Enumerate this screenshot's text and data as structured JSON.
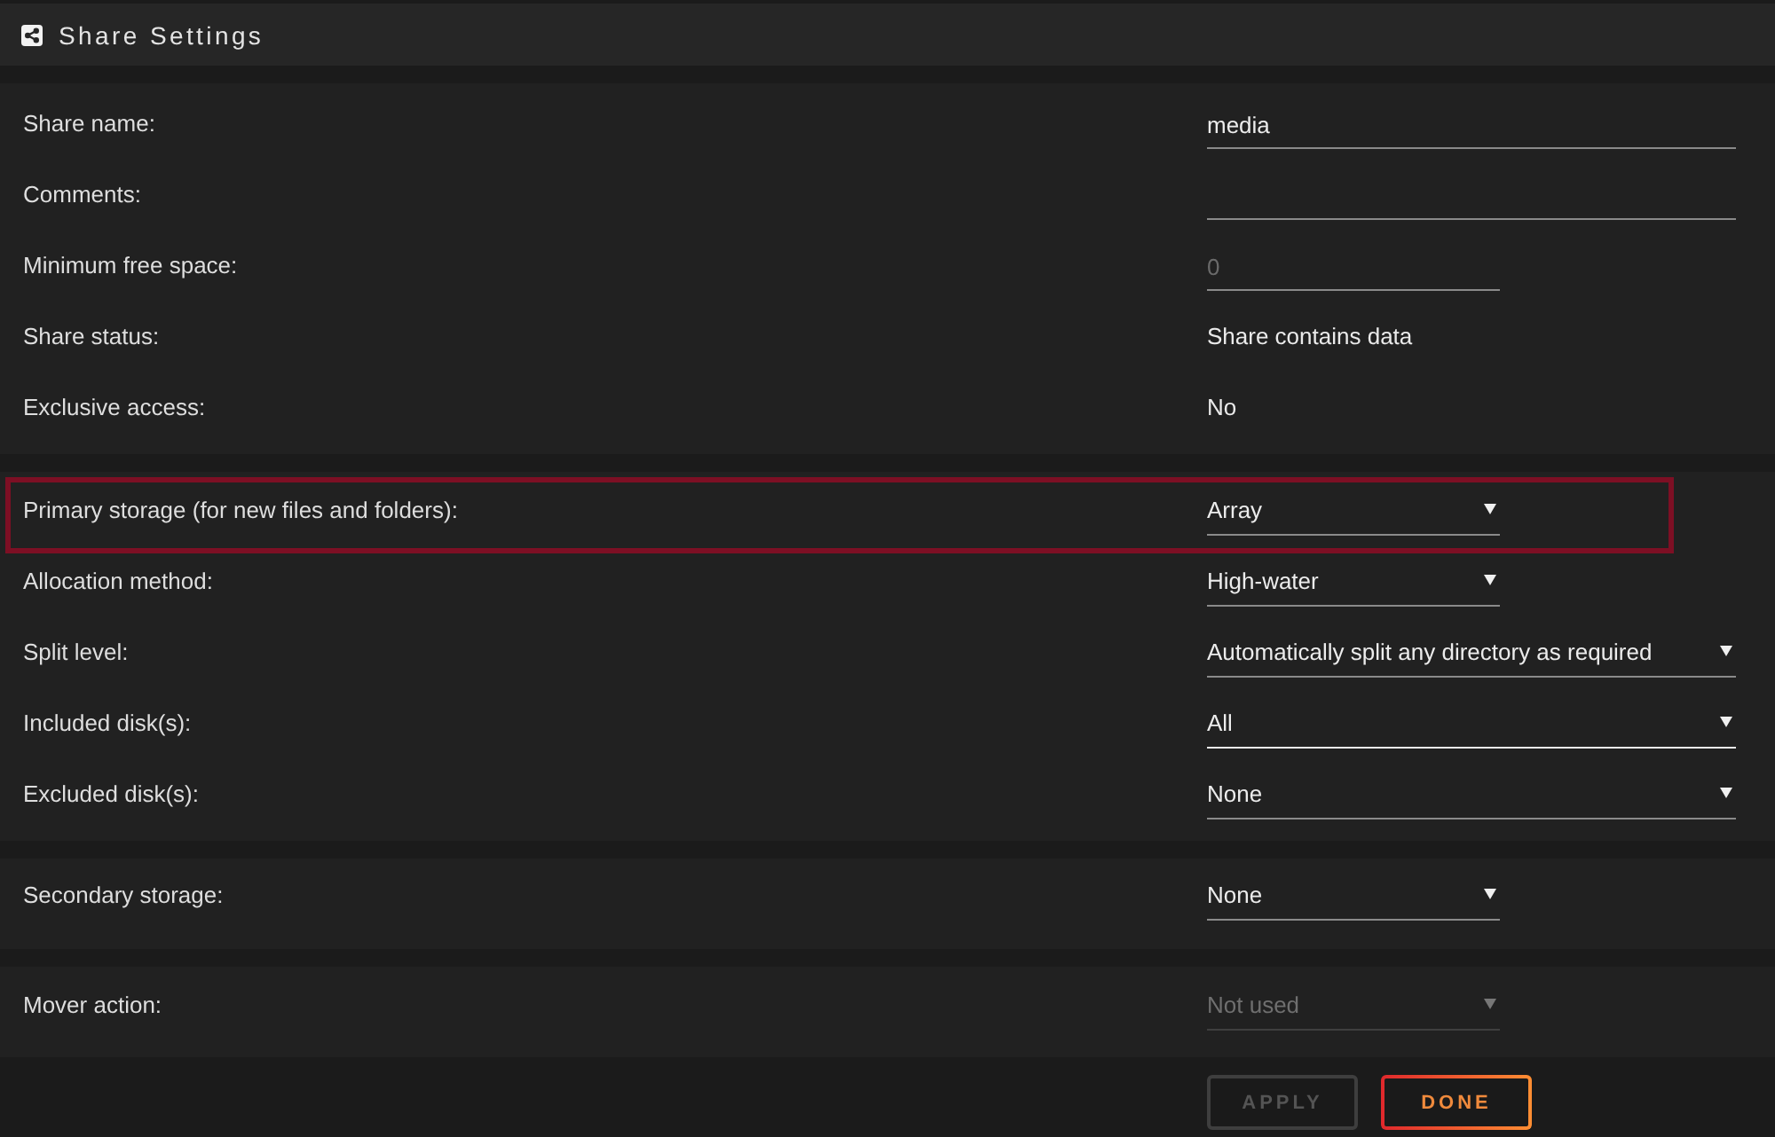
{
  "header": {
    "title": "Share Settings"
  },
  "sections": [
    {
      "rows": [
        {
          "label": "Share name:",
          "kind": "text",
          "value": "media",
          "focused": false,
          "disabled": false,
          "highlighted": false
        },
        {
          "label": "Comments:",
          "kind": "text",
          "focused": false,
          "disabled": false,
          "highlighted": false
        },
        {
          "label": "Minimum free space:",
          "kind": "number",
          "placeholder": "0",
          "focused": false,
          "disabled": false,
          "highlighted": false
        },
        {
          "label": "Share status:",
          "kind": "status",
          "value": "Share contains data",
          "highlighted": false
        },
        {
          "label": "Exclusive access:",
          "kind": "status",
          "value": "No",
          "highlighted": false
        }
      ]
    },
    {
      "rows": [
        {
          "label": "Primary storage (for new files and folders):",
          "kind": "select",
          "value": "Array",
          "focused": false,
          "disabled": false,
          "highlighted": true
        },
        {
          "label": "Allocation method:",
          "kind": "select",
          "value": "High-water",
          "focused": false,
          "disabled": false,
          "highlighted": false
        },
        {
          "label": "Split level:",
          "kind": "select",
          "value": "Automatically split any directory as required",
          "focused": false,
          "disabled": false,
          "highlighted": false
        },
        {
          "label": "Included disk(s):",
          "kind": "select",
          "value": "All",
          "focused": true,
          "disabled": false,
          "highlighted": false
        },
        {
          "label": "Excluded disk(s):",
          "kind": "select",
          "value": "None",
          "focused": false,
          "disabled": false,
          "highlighted": false
        }
      ]
    },
    {
      "rows": [
        {
          "label": "Secondary storage:",
          "kind": "select",
          "value": "None",
          "focused": false,
          "disabled": false,
          "highlighted": false
        }
      ]
    },
    {
      "rows": [
        {
          "label": "Mover action:",
          "kind": "select",
          "value": "Not used",
          "focused": false,
          "disabled": true,
          "highlighted": false
        }
      ]
    }
  ],
  "buttons": [
    {
      "label": "APPLY",
      "disabled": true
    },
    {
      "label": "DONE",
      "disabled": false
    }
  ]
}
